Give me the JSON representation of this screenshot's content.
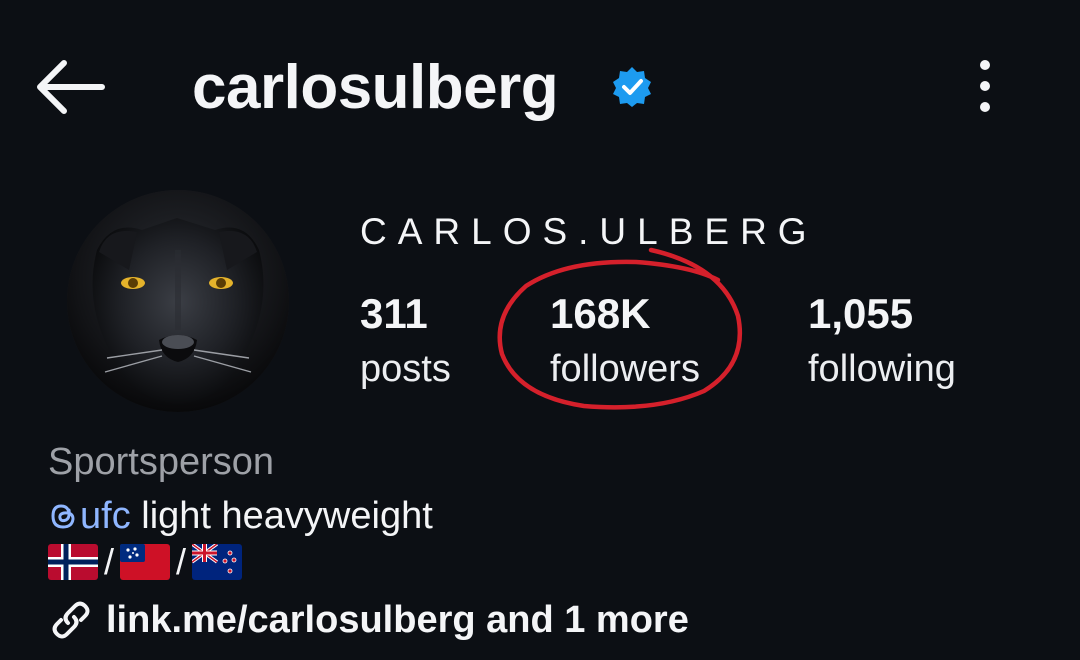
{
  "header": {
    "username": "carlosulberg",
    "verified": true,
    "back_icon": "arrow-left-icon",
    "more_icon": "more-vertical-icon",
    "verified_color": "#1d9bf0"
  },
  "profile": {
    "display_name": "CARLOS.ULBERG",
    "avatar_icon": "black-panther-avatar"
  },
  "stats": {
    "posts": {
      "value": "311",
      "label": "posts"
    },
    "followers": {
      "value": "168K",
      "label": "followers"
    },
    "following": {
      "value": "1,055",
      "label": "following"
    }
  },
  "annotation": {
    "shape": "hand-drawn circle",
    "color": "#d5202b",
    "target": "followers"
  },
  "bio": {
    "category": "Sportsperson",
    "mention": "ufc",
    "mention_rest": " light heavyweight",
    "flags": [
      "norway-flag",
      "samoa-flag",
      "new-zealand-flag"
    ],
    "flag_separator": "/"
  },
  "link": {
    "text": "link.me/carlosulberg and 1 more",
    "icon": "link-icon"
  }
}
